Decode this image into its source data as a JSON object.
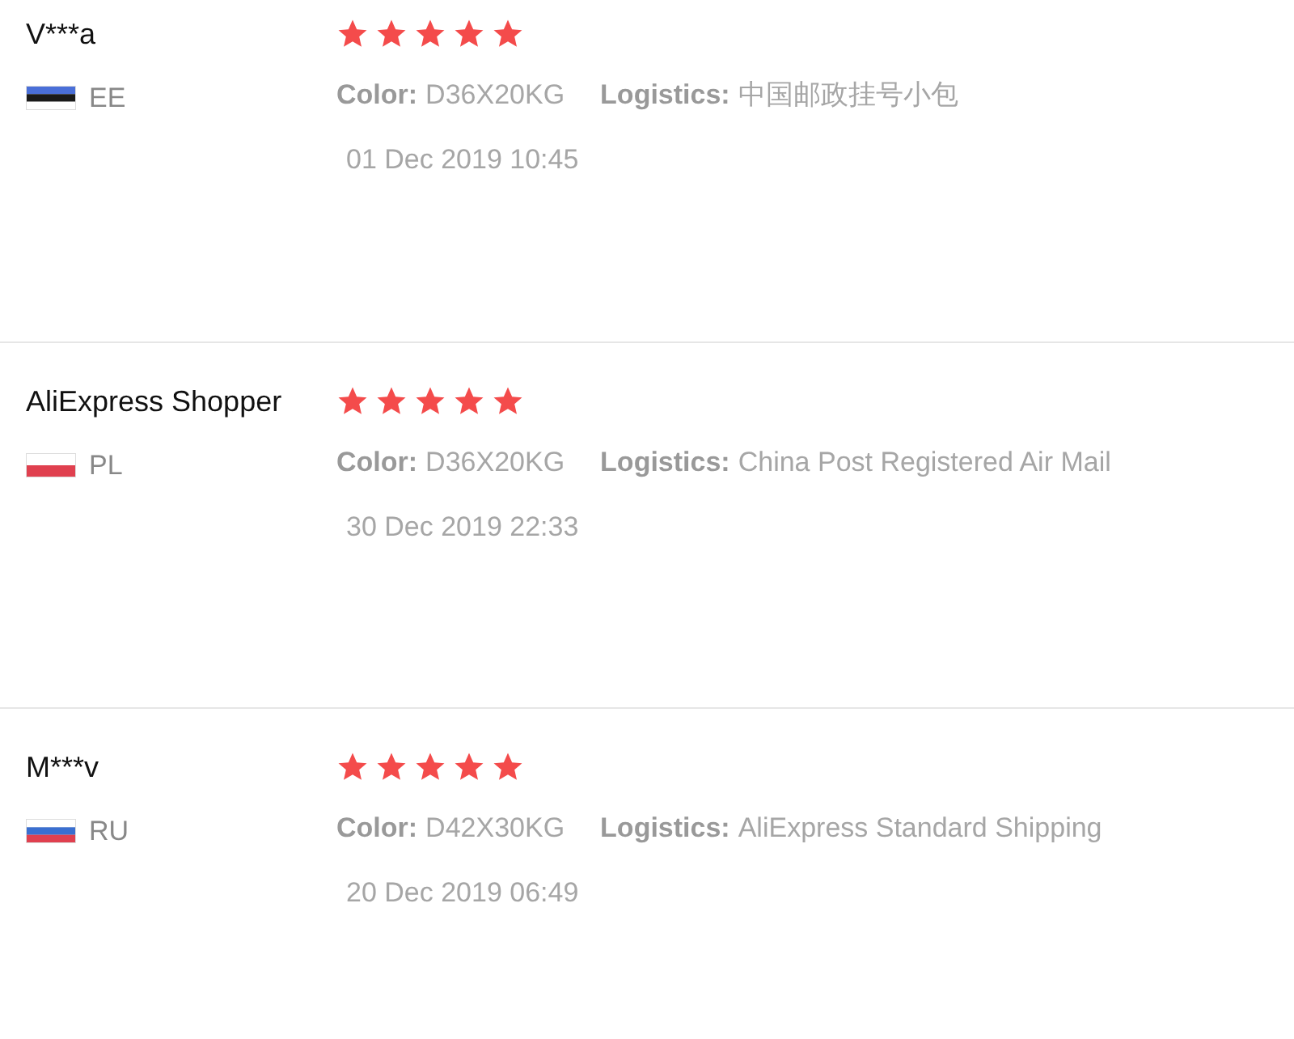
{
  "reviews": [
    {
      "name": "V***a",
      "flag": {
        "kind": "estonia"
      },
      "country": "EE",
      "stars": 5,
      "color_label": "Color:",
      "color_value": "D36X20KG",
      "logistics_label": "Logistics:",
      "logistics_value": "中国邮政挂号小包",
      "date": "01 Dec 2019 10:45"
    },
    {
      "name": "AliExpress Shopper",
      "flag": {
        "kind": "poland"
      },
      "country": "PL",
      "stars": 5,
      "color_label": "Color:",
      "color_value": "D36X20KG",
      "logistics_label": "Logistics:",
      "logistics_value": "China Post Registered Air Mail",
      "date": "30 Dec 2019 22:33"
    },
    {
      "name": "M***v",
      "flag": {
        "kind": "russia"
      },
      "country": "RU",
      "stars": 5,
      "color_label": "Color:",
      "color_value": "D42X30KG",
      "logistics_label": "Logistics:",
      "logistics_value": "AliExpress Standard Shipping",
      "date": "20 Dec 2019 06:49"
    }
  ]
}
